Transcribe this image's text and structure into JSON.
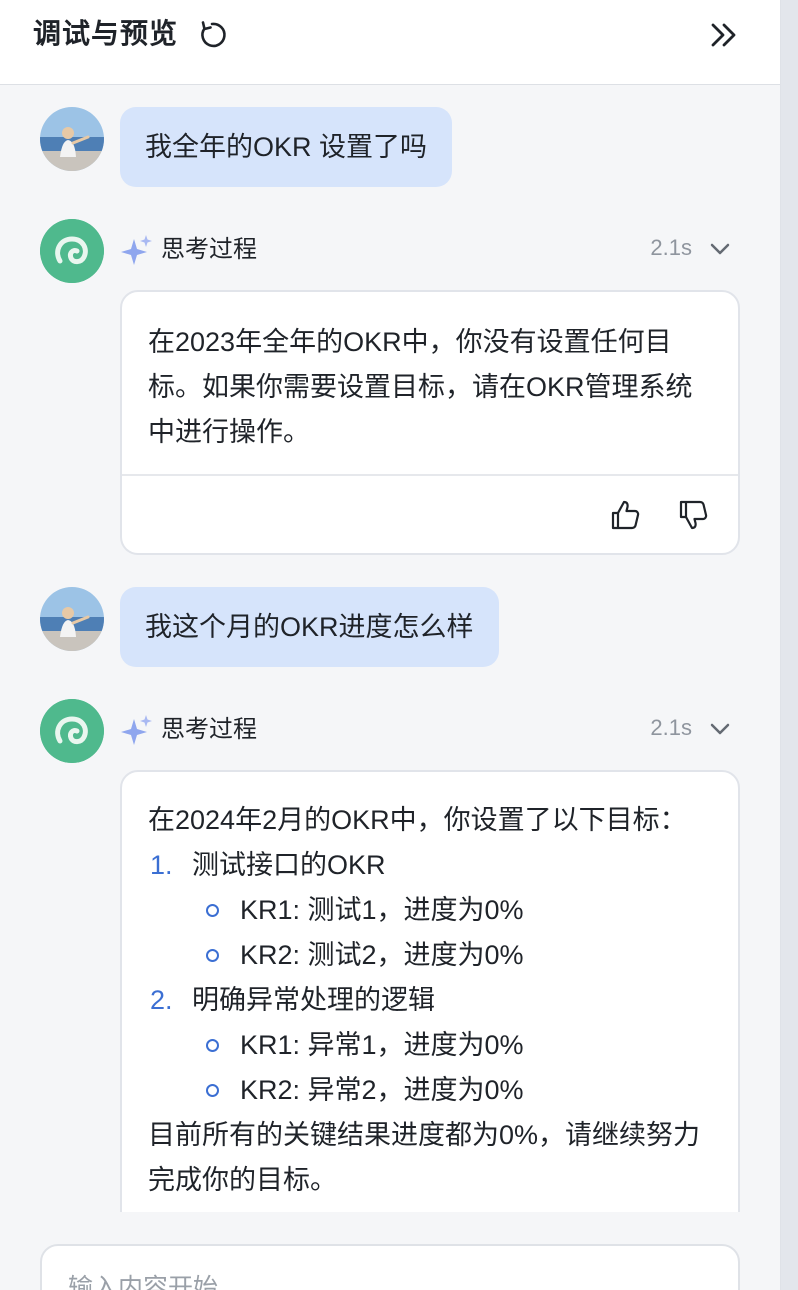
{
  "header": {
    "title": "调试与预览",
    "refresh_icon": "refresh-icon",
    "collapse_icon": "double-chevron-right-icon"
  },
  "messages": [
    {
      "role": "user",
      "text": "我全年的OKR 设置了吗"
    },
    {
      "role": "assistant",
      "thinking_label": "思考过程",
      "elapsed": "2.1s",
      "text": "在2023年全年的OKR中，你没有设置任何目标。如果你需要设置目标，请在OKR管理系统中进行操作。"
    },
    {
      "role": "user",
      "text": "我这个月的OKR进度怎么样"
    },
    {
      "role": "assistant",
      "thinking_label": "思考过程",
      "elapsed": "2.1s",
      "intro": "在2024年2月的OKR中，你设置了以下目标：",
      "objectives": [
        {
          "num": "1.",
          "title": "测试接口的OKR",
          "krs": [
            "KR1: 测试1，进度为0%",
            "KR2: 测试2，进度为0%"
          ]
        },
        {
          "num": "2.",
          "title": "明确异常处理的逻辑",
          "krs": [
            "KR1: 异常1，进度为0%",
            "KR2: 异常2，进度为0%"
          ]
        }
      ],
      "outro": "目前所有的关键结果进度都为0%，请继续努力完成你的目标。"
    }
  ],
  "input": {
    "placeholder": "输入内容开始"
  },
  "colors": {
    "user_bubble": "#d6e4fb",
    "bot_avatar": "#4fb98d",
    "list_accent": "#3b6fd3"
  }
}
